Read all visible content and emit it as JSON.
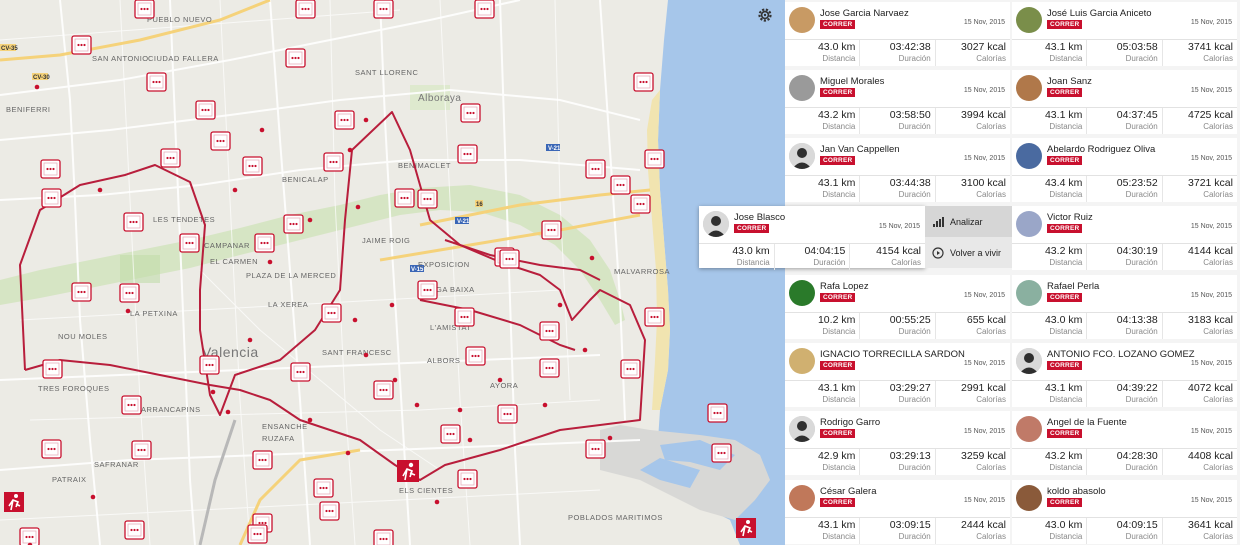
{
  "map": {
    "districts": [
      {
        "label": "PUEBLO NUEVO"
      },
      {
        "label": "CIUDAD FALLERA"
      },
      {
        "label": "SAN ANTONIO"
      },
      {
        "label": "SANT LLORENC"
      },
      {
        "label": "BENIFERRI"
      },
      {
        "label": "Alboraya"
      },
      {
        "label": "BENIMACLET"
      },
      {
        "label": "BENICALAP"
      },
      {
        "label": "LES TENDETES"
      },
      {
        "label": "JAIME ROIG"
      },
      {
        "label": "CAMPANAR"
      },
      {
        "label": "EL CARMEN"
      },
      {
        "label": "PLAZA DE LA MERCED"
      },
      {
        "label": "LA XEREA"
      },
      {
        "label": "EXPOSICION"
      },
      {
        "label": "BEGA BAIXA"
      },
      {
        "label": "LA PETXINA"
      },
      {
        "label": "NOU MOLES"
      },
      {
        "label": "Valencia"
      },
      {
        "label": "L'AMISTAT"
      },
      {
        "label": "SANT FRANCESC"
      },
      {
        "label": "ALBORS"
      },
      {
        "label": "MALVARROSA"
      },
      {
        "label": "TRES FOROQUES"
      },
      {
        "label": "ARRANCAPINS"
      },
      {
        "label": "AYORA"
      },
      {
        "label": "ENSANCHE"
      },
      {
        "label": "RUZAFA"
      },
      {
        "label": "SAFRANAR"
      },
      {
        "label": "PATRAIX"
      },
      {
        "label": "ELS CIENTES"
      },
      {
        "label": "POBLADOS MARITIMOS"
      }
    ],
    "road_labels": [
      {
        "label": "CV-35"
      },
      {
        "label": "CV-30"
      },
      {
        "label": "V-21"
      },
      {
        "label": "V-21"
      },
      {
        "label": "16"
      },
      {
        "label": "V-15"
      }
    ]
  },
  "settings_icon": "gear-icon",
  "badge_color": "#c8102e",
  "route_color": "#b81e3c",
  "labels": {
    "distance": "Distancia",
    "duration": "Duración",
    "calories": "Calorías"
  },
  "cards": [
    {
      "name": "Jose Garcia Narvaez",
      "activity": "CORRER",
      "date": "15 Nov, 2015",
      "distance": "43.0 km",
      "duration": "03:42:38",
      "calories": "3027 kcal",
      "avatar": "#c89a64"
    },
    {
      "name": "José Luis Garcia Aniceto",
      "activity": "CORRER",
      "date": "15 Nov, 2015",
      "distance": "43.1 km",
      "duration": "05:03:58",
      "calories": "3741 kcal",
      "avatar": "#7a8e4a"
    },
    {
      "name": "Miguel Morales",
      "activity": "CORRER",
      "date": "15 Nov, 2015",
      "distance": "43.2 km",
      "duration": "03:58:50",
      "calories": "3994 kcal",
      "avatar": "#9a9a9a"
    },
    {
      "name": "Joan Sanz",
      "activity": "CORRER",
      "date": "15 Nov, 2015",
      "distance": "43.1 km",
      "duration": "04:37:45",
      "calories": "4725 kcal",
      "avatar": "#b0784a"
    },
    {
      "name": "Jan Van Cappellen",
      "activity": "CORRER",
      "date": "15 Nov, 2015",
      "distance": "43.1 km",
      "duration": "03:44:38",
      "calories": "3100 kcal",
      "avatar": "default"
    },
    {
      "name": "Abelardo Rodriguez Oliva",
      "activity": "CORRER",
      "date": "15 Nov, 2015",
      "distance": "43.4 km",
      "duration": "05:23:52",
      "calories": "3721 kcal",
      "avatar": "#4a6aa0"
    },
    {
      "name": "Victor Ruiz",
      "activity": "CORRER",
      "date": "15 Nov, 2015",
      "distance": "43.2 km",
      "duration": "04:30:19",
      "calories": "4144 kcal",
      "avatar": "#9aa6c8"
    },
    {
      "name": "Rafa Lopez",
      "activity": "CORRER",
      "date": "15 Nov, 2015",
      "distance": "10.2 km",
      "duration": "00:55:25",
      "calories": "655 kcal",
      "avatar": "#2a7a2a"
    },
    {
      "name": "Rafael Perla",
      "activity": "CORRER",
      "date": "15 Nov, 2015",
      "distance": "43.0 km",
      "duration": "04:13:38",
      "calories": "3183 kcal",
      "avatar": "#8ab0a0"
    },
    {
      "name": "IGNACIO TORRECILLA SARDON",
      "activity": "CORRER",
      "date": "15 Nov, 2015",
      "distance": "43.1 km",
      "duration": "03:29:27",
      "calories": "2991 kcal",
      "avatar": "#d0b070"
    },
    {
      "name": "ANTONIO FCO. LOZANO GOMEZ",
      "activity": "CORRER",
      "date": "15 Nov, 2015",
      "distance": "43.1 km",
      "duration": "04:39:22",
      "calories": "4072 kcal",
      "avatar": "default"
    },
    {
      "name": "Rodrigo Garro",
      "activity": "CORRER",
      "date": "15 Nov, 2015",
      "distance": "42.9 km",
      "duration": "03:29:13",
      "calories": "3259 kcal",
      "avatar": "default"
    },
    {
      "name": "Angel de la Fuente",
      "activity": "CORRER",
      "date": "15 Nov, 2015",
      "distance": "43.2 km",
      "duration": "04:28:30",
      "calories": "4408 kcal",
      "avatar": "#c07a68"
    },
    {
      "name": "César Galera",
      "activity": "CORRER",
      "date": "15 Nov, 2015",
      "distance": "43.1 km",
      "duration": "03:09:15",
      "calories": "2444 kcal",
      "avatar": "#c0785a"
    },
    {
      "name": "koldo abasolo",
      "activity": "CORRER",
      "date": "15 Nov, 2015",
      "distance": "43.0 km",
      "duration": "04:09:15",
      "calories": "3641 kcal",
      "avatar": "#8a5a3a"
    }
  ],
  "popup": {
    "name": "Jose Blasco",
    "activity": "CORRER",
    "date": "15 Nov, 2015",
    "distance": "43.0 km",
    "duration": "04:04:15",
    "calories": "4154 kcal",
    "avatar": "default"
  },
  "actions": {
    "analyze": "Analizar",
    "replay": "Volver a vivir"
  }
}
